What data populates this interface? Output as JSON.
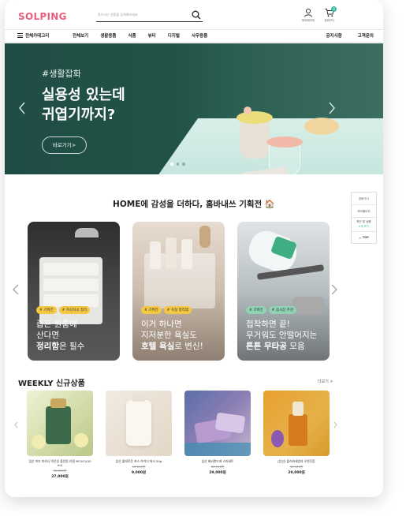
{
  "logo": "SOLPING",
  "search": {
    "placeholder": "찾으시는 상품을 검색해보세요"
  },
  "header_icons": {
    "mypage": "마이페이지",
    "cart": "장바구니",
    "cart_count": "0"
  },
  "nav": {
    "all": "전체카테고리",
    "items": [
      "전체보기",
      "생활용품",
      "식품",
      "뷰티",
      "디지털",
      "사무용품"
    ],
    "right": [
      "공지사항",
      "고객문의"
    ]
  },
  "hero": {
    "tag": "#생활잡화",
    "title": "실용성 있는데\n귀엽기까지?",
    "button": "바로가기>",
    "dots": 3,
    "active_dot": 0
  },
  "side_widget": {
    "cart": "장바구니",
    "mypage": "마이페이지",
    "recent": "최근 본 상품",
    "recent_sub": "0개 보기",
    "top": "TOP"
  },
  "section1": {
    "title": "HOME에 감성을 더하다, 홈바내쓰 기획전 🏠",
    "cards": [
      {
        "tags": [
          "# 기획전",
          "# 차곡차곡 정리"
        ],
        "line1": "좁은 원룸에",
        "line2": "산다면",
        "bold": "정리함",
        "rest": "은 필수"
      },
      {
        "tags": [
          "# 기획전",
          "# 욕실 정리템"
        ],
        "line1": "이거 하나면",
        "line2": "지저분한 욕실도",
        "bold": "호텔 욕실",
        "rest": "로 변신!"
      },
      {
        "tags": [
          "# 기획전",
          "# 꼼시장 추천"
        ],
        "line1": "접착하면 끝!",
        "line2": "무거워도 안떨어지는",
        "bold": "튼튼 무타공",
        "rest": " 모음"
      }
    ]
  },
  "weekly": {
    "title": "WEEKLY 신규상품",
    "more": "더보기 >",
    "products": [
      {
        "name": "임산 피부 미라니 박산성 올인원 리필 MC001(50 ml)",
        "old": "32,000원",
        "price": "27,000원"
      },
      {
        "name": "임산 플레로운 포스 하이더 워시 50g",
        "old": "13,000원",
        "price": "9,000원"
      },
      {
        "name": "임산 배씨랜드에 스파세트",
        "old": "32,000원",
        "price": "29,000원"
      },
      {
        "name": "[임산] 플라워세럼의 우면진음",
        "old": "35,000원",
        "price": "29,000원"
      }
    ]
  },
  "colors": {
    "brand": "#e8607a",
    "hero_bg": "#225247",
    "accent": "#3cb6a0"
  }
}
